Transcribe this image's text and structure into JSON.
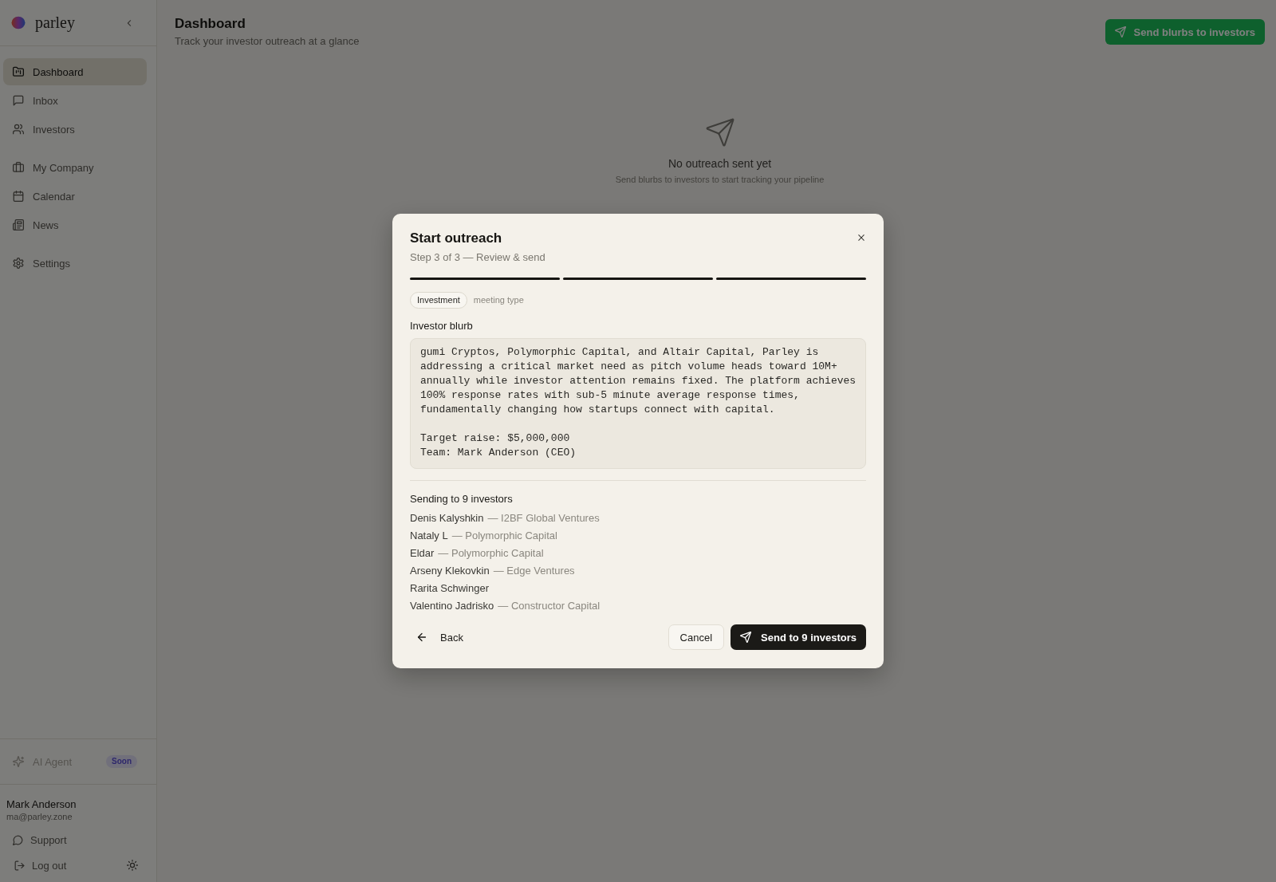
{
  "sidebar": {
    "brand": "parley",
    "nav_groups": [
      {
        "items": [
          {
            "label": "Dashboard",
            "selected": true
          },
          {
            "label": "Inbox",
            "selected": false
          },
          {
            "label": "Investors",
            "selected": false
          }
        ]
      },
      {
        "items": [
          {
            "label": "My Company",
            "selected": false
          },
          {
            "label": "Calendar",
            "selected": false
          },
          {
            "label": "News",
            "selected": false
          }
        ]
      },
      {
        "items": [
          {
            "label": "Settings",
            "selected": false
          }
        ]
      }
    ],
    "ai_agent": {
      "label": "AI Agent",
      "badge": "Soon",
      "disabled": true
    },
    "user": {
      "name": "Mark Anderson",
      "email": "ma@parley.zone"
    },
    "links": [
      {
        "label": "Support"
      },
      {
        "label": "Log out"
      }
    ]
  },
  "header": {
    "title": "Dashboard",
    "subtitle": "Track your investor outreach at a glance",
    "action": "Send blurbs to investors"
  },
  "empty_state": {
    "title": "No outreach sent yet",
    "text": "Send blurbs to investors to start tracking your pipeline"
  },
  "dialog": {
    "title": "Start outreach",
    "step_text": "Step 3 of 3 — Review & send",
    "steps": [
      {
        "completed": true
      },
      {
        "completed": true
      },
      {
        "completed": true
      }
    ],
    "meeting_type": {
      "value": "Investment",
      "label": "meeting type"
    },
    "blurb": {
      "label": "Investor blurb",
      "value": "gumi Cryptos, Polymorphic Capital, and Altair Capital, Parley is addressing a critical market need as pitch volume heads toward 10M+ annually while investor attention remains fixed. The platform achieves 100% response rates with sub-5 minute average response times, fundamentally changing how startups connect with capital.\n\nTarget raise: $5,000,000\nTeam: Mark Anderson (CEO)"
    },
    "recipients": {
      "heading": "Sending to 9 investors",
      "items": [
        {
          "name": "Denis Kalyshkin",
          "firm": "— I2BF Global Ventures"
        },
        {
          "name": "Nataly L",
          "firm": "— Polymorphic Capital"
        },
        {
          "name": "Eldar",
          "firm": "— Polymorphic Capital"
        },
        {
          "name": "Arseny Klekovkin",
          "firm": "— Edge Ventures"
        },
        {
          "name": "Rarita Schwinger"
        },
        {
          "name": "Valentino Jadrisko",
          "firm": "— Constructor Capital"
        }
      ]
    },
    "buttons": {
      "back": "Back",
      "cancel": "Cancel",
      "send": "Send to 9 investors"
    }
  }
}
